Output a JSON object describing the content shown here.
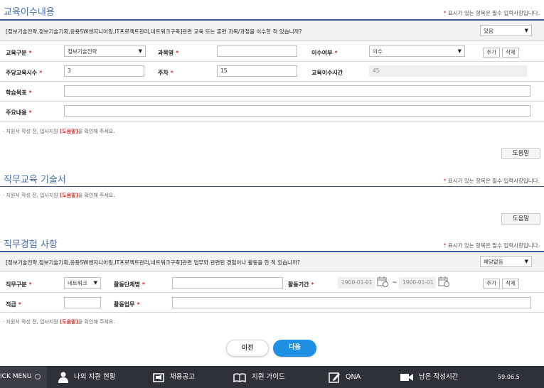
{
  "section1": {
    "title": "교육이수내용",
    "required_note": "표시가 있는 항목은 필수 입력사항입니다.",
    "question": "[정보기술전략,정보기술기획,응용SW엔지니어링,IT프로젝트관리,네트워크구축]관련 교육 또는 훈련 과목/과정을 이수한 적 있습니까?",
    "question_answer": "있음",
    "labels": {
      "edu_type": "교육구분",
      "subject": "과목명",
      "completion": "이수여부",
      "weekly_hours": "주당교육시수",
      "weeks": "주차",
      "total_hours": "교육이수시간",
      "goal": "학습목표",
      "content": "주요내용"
    },
    "values": {
      "edu_type": "정보기술전략",
      "subject": "",
      "completion": "이수",
      "weekly_hours": "3",
      "weeks": "15",
      "total_hours": "45",
      "goal": "",
      "content": ""
    },
    "add_label": "추가",
    "delete_label": "삭제",
    "note_prefix": "지원서 작성 전, 입사지원",
    "note_highlight": "[도움말]",
    "note_suffix": "을 확인해 주세요.",
    "help_label": "도움말"
  },
  "section2": {
    "title": "직무교육 기술서",
    "required_note": "표시가 있는 항목은 필수 입력사항입니다.",
    "note_prefix": "지원서 작성 전, 입사지원",
    "note_highlight": "[도움말]",
    "note_suffix": "을 확인해 주세요.",
    "help_label": "도움말"
  },
  "section3": {
    "title": "직무경험 사항",
    "required_note": "표시가 있는 항목은 필수 입력사항입니다.",
    "question": "[정보기술전략,정보기술기획,응용SW엔지니어링,IT프로젝트관리,네트워크구축]관련 업무와 관련된 경험이나 활동을 한 적 있습니까?",
    "question_answer": "해당없음",
    "labels": {
      "job_type": "직무구분",
      "org": "활동단체명",
      "period": "활동기간",
      "position": "직급",
      "activity": "활동업무"
    },
    "values": {
      "job_type": "네트워크",
      "org": "",
      "start": "1900-01-01",
      "end": "1900-01-01",
      "position": "",
      "activity": ""
    },
    "tilde": "~",
    "add_label": "추가",
    "delete_label": "삭제",
    "note_prefix": "지원서 작성 전, 입사지원",
    "note_highlight": "[도움말]",
    "note_suffix": "을 확인해 주세요."
  },
  "footer": {
    "prev_label": "이전",
    "next_label": "다음"
  },
  "bottom_bar": {
    "quick_menu": "ICK MENU",
    "items": [
      {
        "label": "나의 지원 현황",
        "icon": "person-icon"
      },
      {
        "label": "채용공고",
        "icon": "megaphone-icon"
      },
      {
        "label": "지원 가이드",
        "icon": "book-icon"
      },
      {
        "label": "QNA",
        "icon": "edit-icon"
      },
      {
        "label": "남은 작성시간",
        "icon": "video-icon"
      }
    ],
    "timer": "59:06.5"
  },
  "colors": {
    "accent": "#1e8fe3",
    "title": "#4a6ea8",
    "required": "#d0312d",
    "bar": "#2f3138"
  }
}
